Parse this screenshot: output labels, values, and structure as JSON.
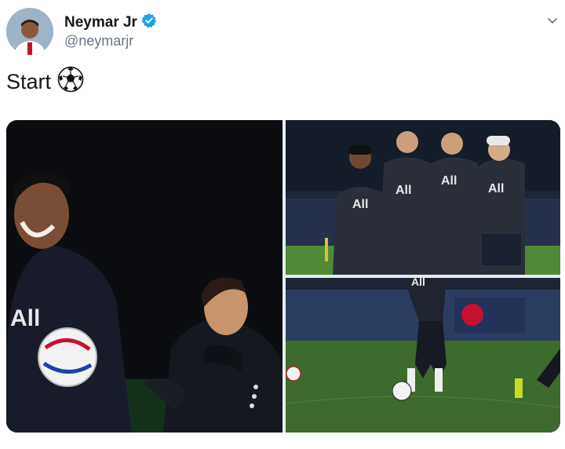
{
  "tweet": {
    "display_name": "Neymar Jr",
    "handle": "@neymarjr",
    "text": "Start",
    "text_emoji": "soccer-ball-icon",
    "verified": true
  },
  "icons": {
    "verified": "verified-badge-icon",
    "menu": "chevron-down-icon"
  },
  "colors": {
    "verified_blue": "#1da1f2",
    "name": "#14171a",
    "handle": "#657786",
    "kit_navy": "#1b2230",
    "pitch_green": "#3f6b2f"
  },
  "media": {
    "count": 3,
    "logo_text": "All"
  }
}
